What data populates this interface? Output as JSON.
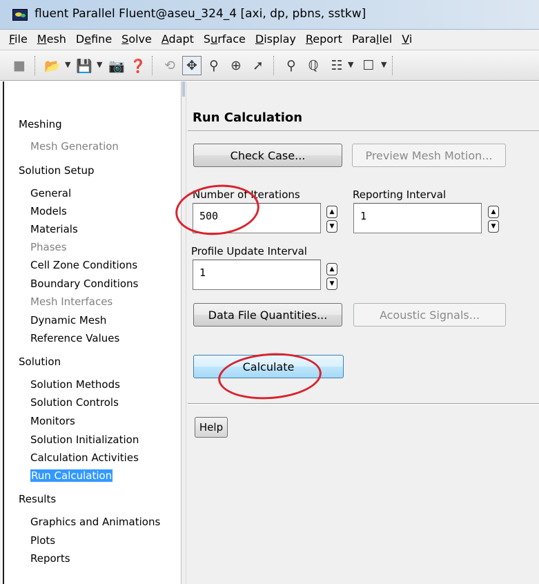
{
  "window": {
    "title": "fluent Parallel Fluent@aseu_324_4  [axi, dp, pbns, sstkw]"
  },
  "menu": [
    {
      "mnemonic": "F",
      "rest": "ile"
    },
    {
      "mnemonic": "M",
      "rest": "esh"
    },
    {
      "pre": "D",
      "mnemonic": "e",
      "rest": "fine"
    },
    {
      "mnemonic": "S",
      "rest": "olve"
    },
    {
      "mnemonic": "A",
      "rest": "dapt"
    },
    {
      "pre": "S",
      "mnemonic": "u",
      "rest": "rface"
    },
    {
      "mnemonic": "D",
      "rest": "isplay"
    },
    {
      "mnemonic": "R",
      "rest": "eport"
    },
    {
      "pre": "Para",
      "mnemonic": "l",
      "rest": "lel"
    },
    {
      "mnemonic": "V",
      "rest": "i"
    }
  ],
  "toolbar_icons": [
    "mesh-icon",
    "open-icon",
    "save-icon",
    "camera-icon",
    "help-icon",
    "rotate-icon",
    "translate-icon",
    "zoom-icon",
    "zoom-in-icon",
    "probe-icon",
    "fit-icon",
    "orient-icon",
    "views-icon",
    "box-icon"
  ],
  "nav": {
    "meshing": "Meshing",
    "mesh_generation": "Mesh Generation",
    "solution_setup": "Solution Setup",
    "general": "General",
    "models": "Models",
    "materials": "Materials",
    "phases": "Phases",
    "cell_zone_conditions": "Cell Zone Conditions",
    "boundary_conditions": "Boundary Conditions",
    "mesh_interfaces": "Mesh Interfaces",
    "dynamic_mesh": "Dynamic Mesh",
    "reference_values": "Reference Values",
    "solution": "Solution",
    "solution_methods": "Solution Methods",
    "solution_controls": "Solution Controls",
    "monitors": "Monitors",
    "solution_initialization": "Solution Initialization",
    "calculation_activities": "Calculation Activities",
    "run_calculation": "Run Calculation",
    "results": "Results",
    "graphics_and_animations": "Graphics and Animations",
    "plots": "Plots",
    "reports": "Reports"
  },
  "panel": {
    "title": "Run Calculation",
    "check_case": "Check Case...",
    "preview_mesh_motion": "Preview Mesh Motion...",
    "number_of_iterations_label": "Number of Iterations",
    "number_of_iterations_value": "500",
    "reporting_interval_label": "Reporting Interval",
    "reporting_interval_value": "1",
    "profile_update_interval_label": "Profile Update Interval",
    "profile_update_interval_value": "1",
    "data_file_quantities": "Data File Quantities...",
    "acoustic_signals": "Acoustic Signals...",
    "calculate": "Calculate",
    "help": "Help"
  },
  "colors": {
    "selection": "#3399ff",
    "annotation": "#d9232d",
    "calculate_button": "#bee6fd"
  }
}
